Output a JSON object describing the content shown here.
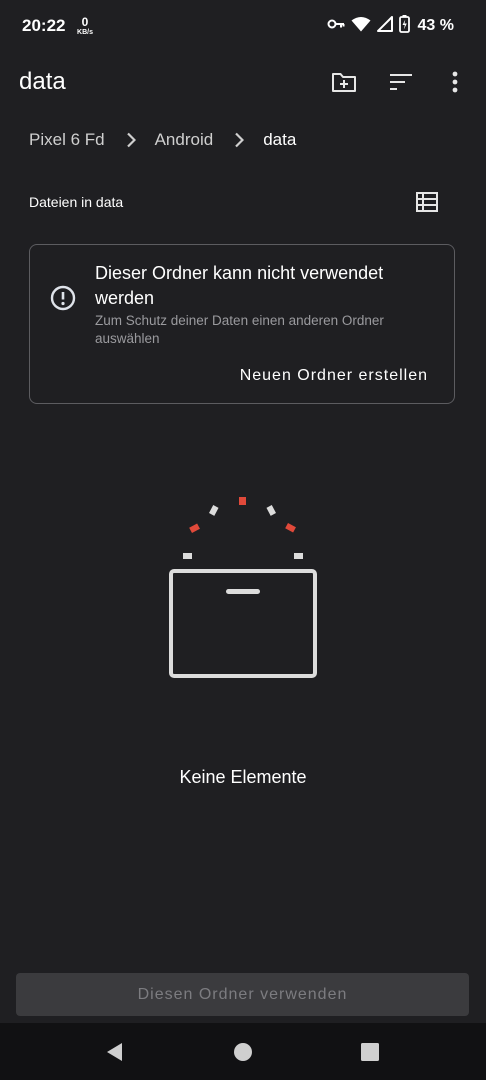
{
  "status_bar": {
    "time": "20:22",
    "net_speed_value": "0",
    "net_speed_unit": "KB/s",
    "battery_percent": "43 %",
    "icons": [
      "vpn-key-icon",
      "wifi-icon",
      "signal-icon",
      "battery-charging-icon"
    ]
  },
  "app_bar": {
    "title": "data",
    "actions": [
      "new-folder-icon",
      "sort-icon",
      "more-vert-icon"
    ]
  },
  "breadcrumb": {
    "items": [
      "Pixel 6 Fd",
      "Android",
      "data"
    ]
  },
  "section": {
    "label": "Dateien in data",
    "view_toggle_icon": "list-view-icon"
  },
  "warning_card": {
    "icon": "info-circle-icon",
    "title": "Dieser Ordner kann nicht verwendet werden",
    "subtitle": "Zum Schutz deiner Daten einen anderen Ordner auswählen",
    "action_label": "Neuen Ordner erstellen"
  },
  "empty_state": {
    "text": "Keine Elemente",
    "illustration": "empty-box-illustration",
    "accent_color": "#e0493a"
  },
  "bottom_button": {
    "label": "Diesen Ordner verwenden",
    "enabled": false
  },
  "nav_bar": {
    "buttons": [
      "back-icon",
      "home-icon",
      "recents-icon"
    ]
  }
}
